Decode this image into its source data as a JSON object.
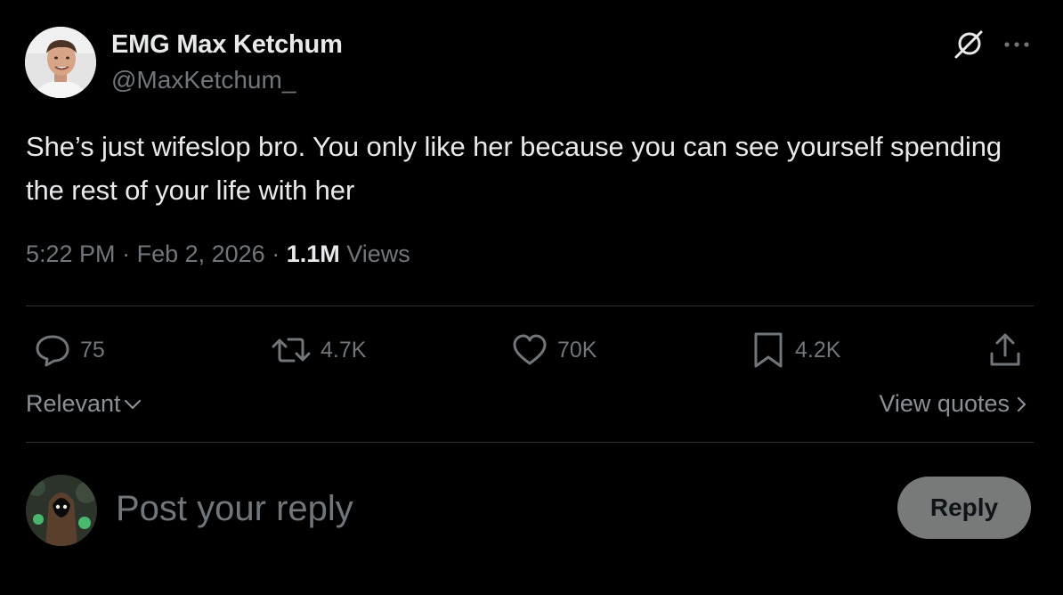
{
  "author": {
    "display_name": "EMG Max Ketchum",
    "handle": "@MaxKetchum_"
  },
  "tweet": {
    "text": "She’s just wifeslop bro. You only like her because you can see yourself spending the rest of your life with her",
    "time": "5:22 PM",
    "date": "Feb 2, 2026",
    "views_count": "1.1M",
    "views_label": "Views"
  },
  "actions": {
    "replies": "75",
    "reposts": "4.7K",
    "likes": "70K",
    "bookmarks": "4.2K"
  },
  "filters": {
    "sort_label": "Relevant",
    "view_quotes_label": "View quotes"
  },
  "reply_box": {
    "placeholder": "Post your reply",
    "button_label": "Reply"
  },
  "icons": {
    "header": [
      "grok-icon",
      "more-icon"
    ],
    "actions": [
      "reply-icon",
      "repost-icon",
      "like-icon",
      "bookmark-icon",
      "share-icon"
    ],
    "misc": [
      "chevron-down-icon",
      "chevron-right-icon"
    ]
  },
  "colors": {
    "background": "#000000",
    "primary_text": "#e7e9ea",
    "secondary_text": "#71767b",
    "divider": "#2f3336",
    "reply_button_bg": "#787a7a"
  }
}
